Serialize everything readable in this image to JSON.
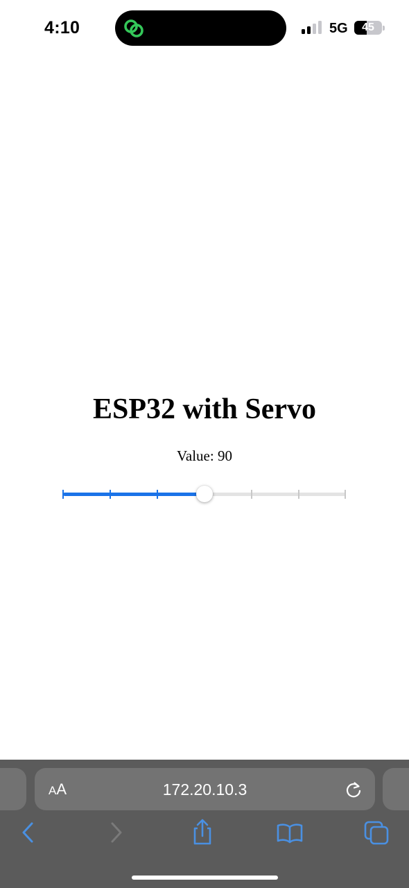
{
  "status_bar": {
    "time": "4:10",
    "network": "5G",
    "battery_level": "45",
    "signal_bars_active": 2,
    "signal_bars_total": 4,
    "link_icon_color": "#34c759"
  },
  "page": {
    "title": "ESP32 with Servo",
    "value_label": "Value: 90"
  },
  "slider": {
    "min": 0,
    "max": 180,
    "value": 90,
    "tick_count": 7,
    "accent_color": "#1a73e8"
  },
  "browser": {
    "aa_small": "A",
    "aa_large": "A",
    "url": "172.20.10.3",
    "icons": [
      "reload-icon",
      "back-icon",
      "forward-icon",
      "share-icon",
      "bookmarks-icon",
      "tabs-icon"
    ],
    "toolbar_color": "#5b5b5b",
    "icon_color": "#4a90e2"
  }
}
